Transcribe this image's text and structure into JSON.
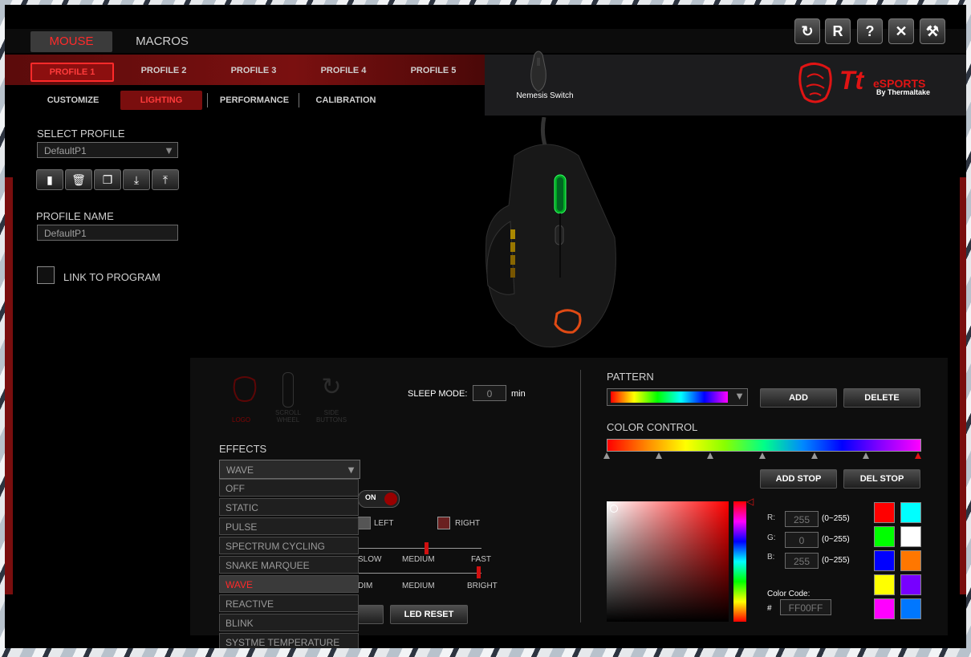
{
  "nav": {
    "tabs": [
      "MOUSE",
      "MACROS"
    ]
  },
  "window_buttons": {
    "refresh": "↻",
    "reset": "R",
    "help": "?",
    "close": "✕",
    "settings": "⚒"
  },
  "brand": {
    "logo_text": "Tt",
    "name": "eSPORTS",
    "by": "By Thermaltake"
  },
  "device": {
    "name": "Nemesis Switch"
  },
  "profiles": [
    "PROFILE 1",
    "PROFILE 2",
    "PROFILE 3",
    "PROFILE 4",
    "PROFILE 5"
  ],
  "subtabs": [
    "CUSTOMIZE",
    "LIGHTING",
    "PERFORMANCE",
    "CALIBRATION"
  ],
  "left": {
    "select_profile_label": "SELECT PROFILE",
    "select_profile_value": "DefaultP1",
    "profile_name_label": "PROFILE NAME",
    "profile_name_value": "DefaultP1",
    "link_label": "LINK TO PROGRAM"
  },
  "zones": {
    "logo": "LOGO",
    "scroll": "SCROLL WHEEL",
    "side": "SIDE BUTTONS"
  },
  "sleep": {
    "label": "SLEEP MODE:",
    "value": "0",
    "unit": "min"
  },
  "effects": {
    "label": "EFFECTS",
    "selected": "WAVE",
    "options": [
      "OFF",
      "STATIC",
      "PULSE",
      "SPECTRUM CYCLING",
      "SNAKE MARQUEE",
      "WAVE",
      "REACTIVE",
      "BLINK",
      "SYSTME TEMPERATURE"
    ]
  },
  "toggle": {
    "label": "ON",
    "on": true
  },
  "direction": {
    "left": "LEFT",
    "right": "RIGHT"
  },
  "speed": {
    "labels": [
      "SLOW",
      "MEDIUM",
      "FAST"
    ],
    "value": 0.55
  },
  "brightness": {
    "labels": [
      "DIM",
      "MEDIUM",
      "BRIGHT"
    ],
    "value": 1.0
  },
  "led_reset": "LED RESET",
  "pattern": {
    "label": "PATTERN",
    "add": "ADD",
    "delete": "DELETE"
  },
  "color_control": {
    "label": "COLOR CONTROL",
    "add_stop": "ADD STOP",
    "del_stop": "DEL STOP",
    "stops": 7
  },
  "rgb": {
    "r_label": "R:",
    "r": "255",
    "g_label": "G:",
    "g": "0",
    "b_label": "B:",
    "b": "255",
    "range": "(0~255)",
    "code_label": "Color Code:",
    "hash": "#",
    "code": "FF00FF"
  },
  "swatches": [
    "#ff0000",
    "#00ffff",
    "#00ff00",
    "#ffffff",
    "#0000ff",
    "#ff7700",
    "#ffff00",
    "#7700ff",
    "#ff00ff",
    "#0077ff"
  ],
  "colors": {
    "accent": "#ff2a2a",
    "dark_red": "#7a0e0e"
  }
}
